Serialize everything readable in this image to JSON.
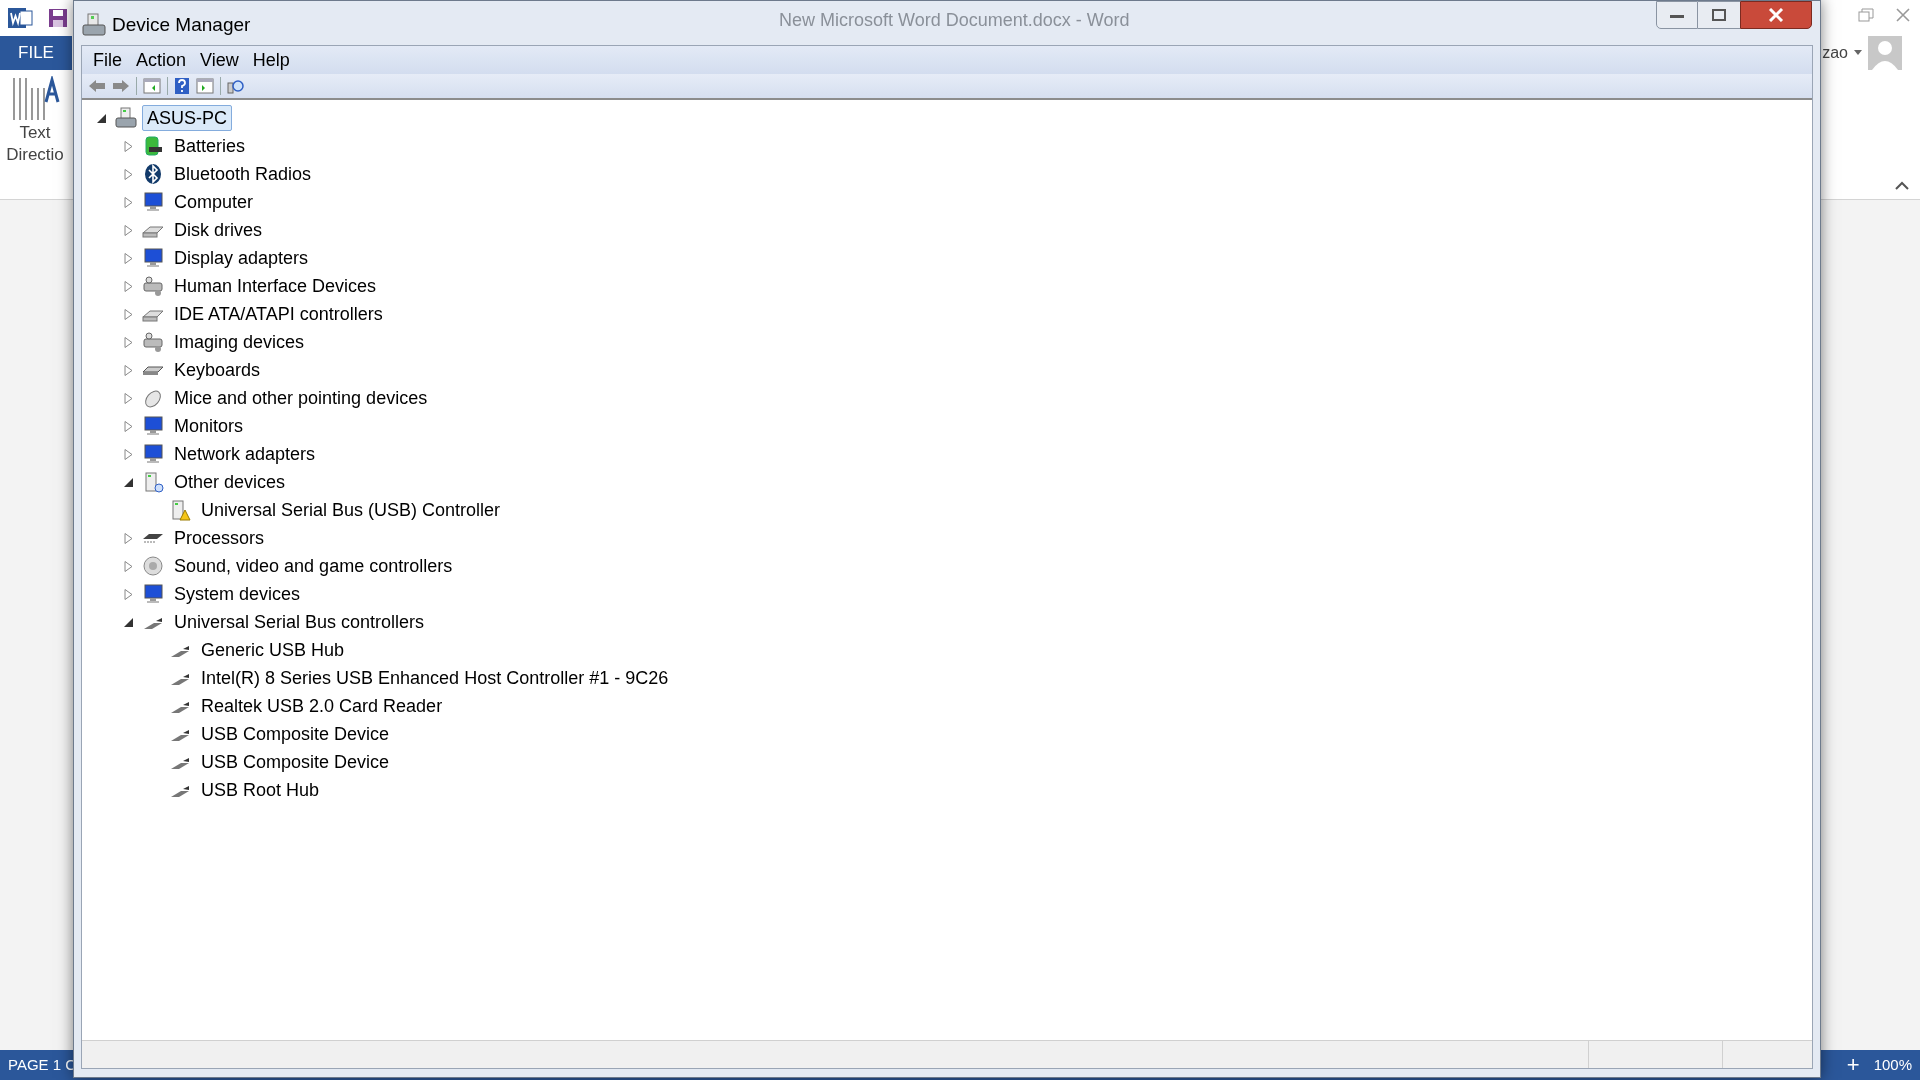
{
  "word": {
    "ribbon_tab": "FILE",
    "ribbon_button": [
      "Text",
      "Directio"
    ],
    "account": "zao",
    "status_page": "PAGE 1 C",
    "zoom_plus": "+",
    "zoom": "100%"
  },
  "window": {
    "title": "Device Manager",
    "behind_title": "New Microsoft Word Document.docx - Word"
  },
  "menu": [
    "File",
    "Action",
    "View",
    "Help"
  ],
  "tree": {
    "label": "ASUS-PC",
    "expanded": true,
    "selected": true,
    "children": [
      {
        "label": "Batteries",
        "expanded": false,
        "selected": false
      },
      {
        "label": "Bluetooth Radios",
        "expanded": false,
        "selected": false
      },
      {
        "label": "Computer",
        "expanded": false,
        "selected": false
      },
      {
        "label": "Disk drives",
        "expanded": false,
        "selected": false
      },
      {
        "label": "Display adapters",
        "expanded": false,
        "selected": false
      },
      {
        "label": "Human Interface Devices",
        "expanded": false,
        "selected": false
      },
      {
        "label": "IDE ATA/ATAPI controllers",
        "expanded": false,
        "selected": false
      },
      {
        "label": "Imaging devices",
        "expanded": false,
        "selected": false
      },
      {
        "label": "Keyboards",
        "expanded": false,
        "selected": false
      },
      {
        "label": "Mice and other pointing devices",
        "expanded": false,
        "selected": false
      },
      {
        "label": "Monitors",
        "expanded": false,
        "selected": false
      },
      {
        "label": "Network adapters",
        "expanded": false,
        "selected": false
      },
      {
        "label": "Other devices",
        "expanded": true,
        "selected": false,
        "children": [
          {
            "label": "Universal Serial Bus (USB) Controller",
            "selected": false
          }
        ]
      },
      {
        "label": "Processors",
        "expanded": false,
        "selected": false
      },
      {
        "label": "Sound, video and game controllers",
        "expanded": false,
        "selected": false
      },
      {
        "label": "System devices",
        "expanded": false,
        "selected": false
      },
      {
        "label": "Universal Serial Bus controllers",
        "expanded": true,
        "selected": false,
        "children": [
          {
            "label": "Generic USB Hub",
            "selected": false
          },
          {
            "label": "Intel(R) 8 Series USB Enhanced Host Controller #1 - 9C26",
            "selected": false
          },
          {
            "label": "Realtek USB 2.0 Card Reader",
            "selected": false
          },
          {
            "label": "USB Composite Device",
            "selected": false
          },
          {
            "label": "USB Composite Device",
            "selected": false
          },
          {
            "label": "USB Root Hub",
            "selected": false
          }
        ]
      }
    ]
  }
}
